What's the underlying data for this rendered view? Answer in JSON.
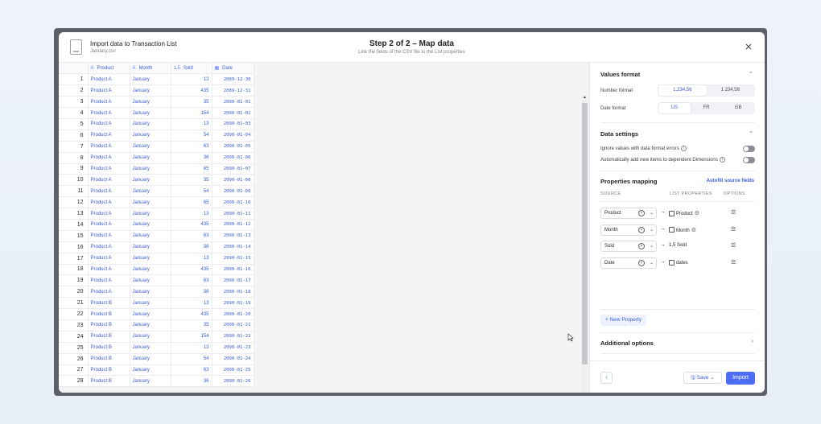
{
  "header": {
    "title": "Import data to Transaction List",
    "file_name": "January.csv",
    "file_icon_label": "csv",
    "step_title": "Step 2 of 2 – Map data",
    "step_subtitle": "Link the fields of the CSV file to the List properties"
  },
  "grid": {
    "columns": [
      {
        "label": "Product",
        "icon": "A"
      },
      {
        "label": "Month",
        "icon": "A"
      },
      {
        "label": "Sold",
        "icon": "1,5"
      },
      {
        "label": "Date",
        "icon": "▦"
      }
    ],
    "rows": [
      [
        "1",
        "Product A",
        "January",
        "13",
        "2089-12-30"
      ],
      [
        "2",
        "Product A",
        "January",
        "435",
        "2089-12-31"
      ],
      [
        "3",
        "Product A",
        "January",
        "35",
        "2090-01-01"
      ],
      [
        "4",
        "Product A",
        "January",
        "154",
        "2090-01-02"
      ],
      [
        "5",
        "Product A",
        "January",
        "13",
        "2090-01-03"
      ],
      [
        "6",
        "Product A",
        "January",
        "54",
        "2090-01-04"
      ],
      [
        "7",
        "Product A",
        "January",
        "63",
        "2090-01-05"
      ],
      [
        "8",
        "Product A",
        "January",
        "36",
        "2090-01-06"
      ],
      [
        "9",
        "Product A",
        "January",
        "65",
        "2090-01-07"
      ],
      [
        "10",
        "Product A",
        "January",
        "35",
        "2090-01-08"
      ],
      [
        "11",
        "Product A",
        "January",
        "54",
        "2090-01-09"
      ],
      [
        "12",
        "Product A",
        "January",
        "65",
        "2090-01-10"
      ],
      [
        "13",
        "Product A",
        "January",
        "13",
        "2090-01-11"
      ],
      [
        "14",
        "Product A",
        "January",
        "435",
        "2090-01-12"
      ],
      [
        "15",
        "Product A",
        "January",
        "63",
        "2090-01-13"
      ],
      [
        "16",
        "Product A",
        "January",
        "36",
        "2090-01-14"
      ],
      [
        "17",
        "Product A",
        "January",
        "13",
        "2090-01-15"
      ],
      [
        "18",
        "Product A",
        "January",
        "435",
        "2090-01-16"
      ],
      [
        "19",
        "Product A",
        "January",
        "63",
        "2090-01-17"
      ],
      [
        "20",
        "Product A",
        "January",
        "36",
        "2090-01-18"
      ],
      [
        "21",
        "Product B",
        "January",
        "13",
        "2090-01-19"
      ],
      [
        "22",
        "Product B",
        "January",
        "435",
        "2090-01-20"
      ],
      [
        "23",
        "Product B",
        "January",
        "35",
        "2090-01-21"
      ],
      [
        "24",
        "Product B",
        "January",
        "154",
        "2090-01-22"
      ],
      [
        "25",
        "Product B",
        "January",
        "13",
        "2090-01-23"
      ],
      [
        "26",
        "Product B",
        "January",
        "54",
        "2090-01-24"
      ],
      [
        "27",
        "Product B",
        "January",
        "63",
        "2090-01-25"
      ],
      [
        "28",
        "Product B",
        "January",
        "36",
        "2090-01-26"
      ]
    ]
  },
  "values_format": {
    "title": "Values format",
    "number_format_label": "Number format",
    "number_options": [
      "1,234,56",
      "1 234,56"
    ],
    "number_selected": "1,234,56",
    "date_format_label": "Date format",
    "date_options": [
      "US",
      "FR",
      "GB"
    ],
    "date_selected": "US"
  },
  "data_settings": {
    "title": "Data settings",
    "ignore_label": "Ignore values with data format errors",
    "auto_add_label": "Automatically add new items to dependent Dimensions"
  },
  "mapping": {
    "title": "Properties mapping",
    "autofill": "Autofill source fields",
    "col_source": "SOURCE",
    "col_list": "LIST PROPERTIES",
    "col_options": "OPTIONS",
    "rows": [
      {
        "source": "Product",
        "target": "Product",
        "target_icon": "dimension",
        "gear": true
      },
      {
        "source": "Month",
        "target": "Month",
        "target_icon": "dimension",
        "gear": true
      },
      {
        "source": "Sold",
        "target": "Sold",
        "target_prefix": "1,5",
        "gear": false
      },
      {
        "source": "Date",
        "target": "dates",
        "target_icon": "calendar",
        "gear": false
      }
    ],
    "new_property": "+ New Property"
  },
  "additional": {
    "title": "Additional options"
  },
  "footer": {
    "back": "‹",
    "save": "Save",
    "import": "Import"
  },
  "colors": {
    "accent": "#4c6ef5",
    "link": "#3b5bdb"
  }
}
